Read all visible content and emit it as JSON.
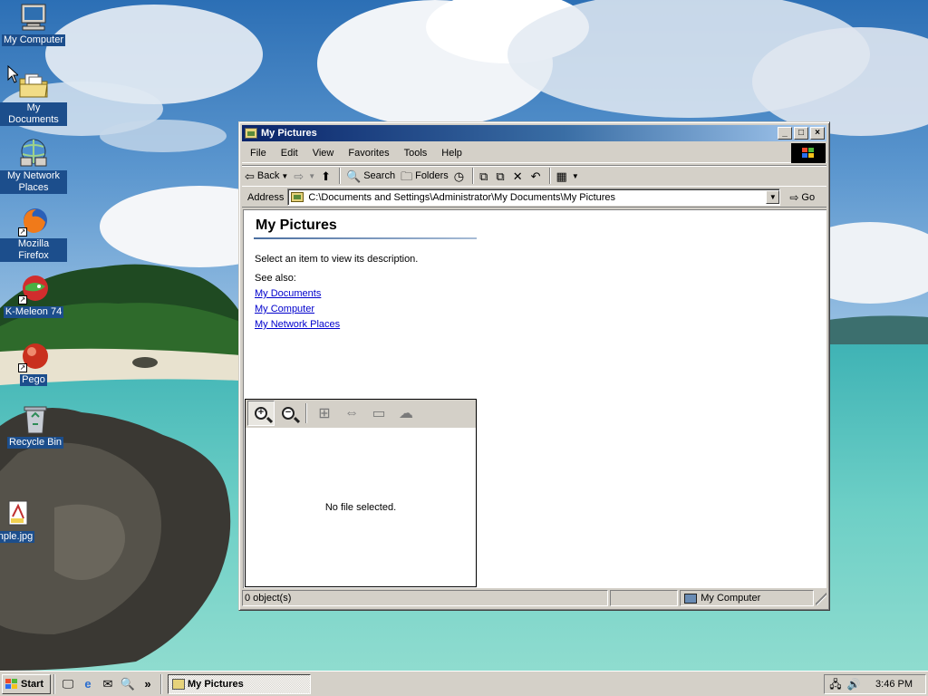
{
  "desktop": {
    "icons": [
      {
        "label": "My Computer",
        "icon": "my-computer-icon"
      },
      {
        "label": "My Documents",
        "icon": "my-documents-icon"
      },
      {
        "label": "My Network Places",
        "icon": "network-places-icon"
      },
      {
        "label": "Mozilla Firefox",
        "icon": "firefox-icon"
      },
      {
        "label": "K-Meleon 74",
        "icon": "k-meleon-icon"
      },
      {
        "label": "Pego",
        "icon": "pego-icon"
      },
      {
        "label": "Recycle Bin",
        "icon": "recycle-bin-icon"
      },
      {
        "label": "nple.jpg",
        "icon": "jpg-file-icon"
      }
    ]
  },
  "window": {
    "title": "My Pictures",
    "caption_buttons": {
      "minimize": "_",
      "maximize": "□",
      "close": "×"
    },
    "menu": [
      "File",
      "Edit",
      "View",
      "Favorites",
      "Tools",
      "Help"
    ],
    "toolbar": {
      "back": "Back",
      "search": "Search",
      "folders": "Folders"
    },
    "address": {
      "label": "Address",
      "value": "C:\\Documents and Settings\\Administrator\\My Documents\\My Pictures",
      "go": "Go"
    },
    "task_pane": {
      "title": "My Pictures",
      "description": "Select an item to view its description.",
      "see_also_label": "See also:",
      "links": [
        "My Documents",
        "My Computer",
        "My Network Places"
      ]
    },
    "preview": {
      "message": "No file selected."
    },
    "status": {
      "objects": "0 object(s)",
      "zone": "My Computer"
    }
  },
  "taskbar": {
    "start": "Start",
    "chevron": "»",
    "task": "My Pictures",
    "clock": "3:46 PM"
  },
  "colors": {
    "titlebar_start": "#0a246a",
    "titlebar_end": "#a6caf0",
    "face": "#d4d0c8",
    "link": "#0000cc"
  }
}
